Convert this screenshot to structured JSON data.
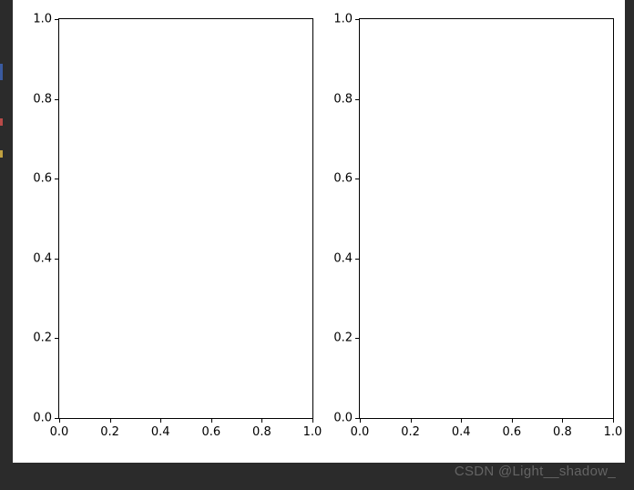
{
  "chart_data": [
    {
      "type": "line",
      "series": [],
      "x": [],
      "xlim": [
        0.0,
        1.0
      ],
      "ylim": [
        0.0,
        1.0
      ],
      "xticks": [
        0.0,
        0.2,
        0.4,
        0.6,
        0.8,
        1.0
      ],
      "yticks": [
        0.0,
        0.2,
        0.4,
        0.6,
        0.8,
        1.0
      ],
      "xticklabels": [
        "0.0",
        "0.2",
        "0.4",
        "0.6",
        "0.8",
        "1.0"
      ],
      "yticklabels": [
        "0.0",
        "0.2",
        "0.4",
        "0.6",
        "0.8",
        "1.0"
      ],
      "title": "",
      "xlabel": "",
      "ylabel": "",
      "grid": false
    },
    {
      "type": "line",
      "series": [],
      "x": [],
      "xlim": [
        0.0,
        1.0
      ],
      "ylim": [
        0.0,
        1.0
      ],
      "xticks": [
        0.0,
        0.2,
        0.4,
        0.6,
        0.8,
        1.0
      ],
      "yticks": [
        0.0,
        0.2,
        0.4,
        0.6,
        0.8,
        1.0
      ],
      "xticklabels": [
        "0.0",
        "0.2",
        "0.4",
        "0.6",
        "0.8",
        "1.0"
      ],
      "yticklabels": [
        "0.0",
        "0.2",
        "0.4",
        "0.6",
        "0.8",
        "1.0"
      ],
      "title": "",
      "xlabel": "",
      "ylabel": "",
      "grid": false
    }
  ],
  "watermark": "CSDN @Light__shadow_"
}
